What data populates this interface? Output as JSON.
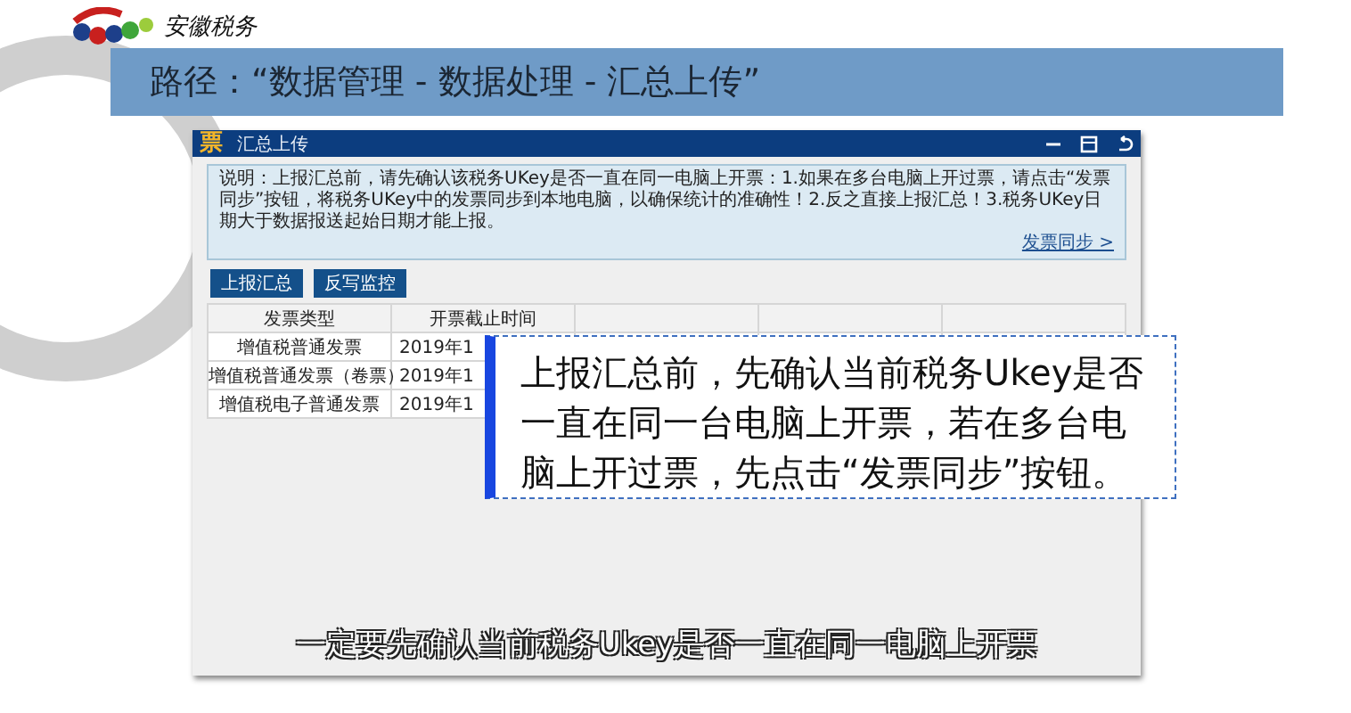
{
  "brand": {
    "name": "安徽税务"
  },
  "banner": {
    "title": "路径：“数据管理 - 数据处理 - 汇总上传”"
  },
  "window": {
    "app_icon": "票",
    "title": "汇总上传"
  },
  "notice": {
    "text": "说明：上报汇总前，请先确认该税务UKey是否一直在同一电脑上开票：1.如果在多台电脑上开过票，请点击“发票同步”按钮，将税务UKey中的发票同步到本地电脑，以确保统计的准确性！2.反之直接上报汇总！3.税务UKey日期大于数据报送起始日期才能上报。",
    "link": "发票同步 >"
  },
  "buttons": [
    "上报汇总",
    "反写监控"
  ],
  "table": {
    "columns": [
      "发票类型",
      "开票截止时间"
    ],
    "rows": [
      [
        "增值税普通发票",
        "2019年1"
      ],
      [
        "增值税普通发票（卷票）",
        "2019年1"
      ],
      [
        "增值税电子普通发票",
        "2019年1"
      ]
    ]
  },
  "callout": {
    "text": "上报汇总前，先确认当前税务Ukey是否一直在同一台电脑上开票，若在多台电脑上开过票，先点击“发票同步”按钮。"
  },
  "subtitle": {
    "text": "一定要先确认当前税务Ukey是否一直在同一电脑上开票"
  }
}
